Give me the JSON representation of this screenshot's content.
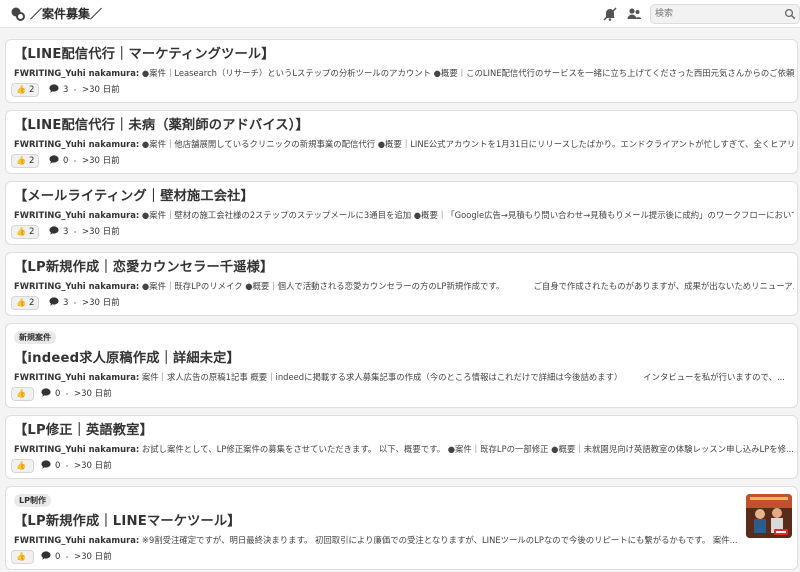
{
  "header": {
    "channel_title": "／案件募集／",
    "search_placeholder": "検索"
  },
  "posts": [
    {
      "tag": "",
      "title": "【LINE配信代行｜マーケティングツール】",
      "author": "FWRITING_Yuhi nakamura:",
      "preview": "●案件｜Leasearch（リサーチ）というLステップの分析ツールのアカウント ●概要｜このLINE配信代行のサービスを一緒に立ち上げてくださった西田元気さんからのご依頼...",
      "reaction_emoji": "👍",
      "reaction_count": "2",
      "replies": "3",
      "time": ">30 日前",
      "has_thumbnail": false
    },
    {
      "tag": "",
      "title": "【LINE配信代行｜未病（薬剤師のアドバイス）】",
      "author": "FWRITING_Yuhi nakamura:",
      "preview": "●案件｜他店舗展開しているクリニックの新規事業の配信代行 ●概要｜LINE公式アカウントを1月31日にリリースしたばかり。エンドクライアントが忙しすぎて、全くヒアリン...",
      "reaction_emoji": "👍",
      "reaction_count": "2",
      "replies": "0",
      "time": ">30 日前",
      "has_thumbnail": false
    },
    {
      "tag": "",
      "title": "【メールライティング｜壁材施工会社】",
      "author": "FWRITING_Yuhi nakamura:",
      "preview": "●案件｜壁材の施工会社様の2ステップのステップメールに3通目を追加 ●概要｜「Google広告→見積もり問い合わせ→見積もりメール提示後に成約」のワークフローにおいて...",
      "reaction_emoji": "👍",
      "reaction_count": "2",
      "replies": "3",
      "time": ">30 日前",
      "has_thumbnail": false
    },
    {
      "tag": "",
      "title": "【LP新規作成｜恋愛カウンセラー千遥様】",
      "author": "FWRITING_Yuhi nakamura:",
      "preview": "●案件｜既存LPのリメイク ●概要｜個人で活動される恋愛カウンセラーの方のLP新規作成です。　　　　ご自身で作成されたものがありますが、成果が出ないためリニューア...",
      "reaction_emoji": "👍",
      "reaction_count": "2",
      "replies": "3",
      "time": ">30 日前",
      "has_thumbnail": false
    },
    {
      "tag": "新規案件",
      "title": "【indeed求人原稿作成｜詳細未定】",
      "author": "FWRITING_Yuhi nakamura:",
      "preview": "案件｜求人広告の原稿1記事 概要｜indeedに掲載する求人募集記事の作成（今のところ情報はこれだけで詳細は今後詰めます）　　　インタビューを私が行いますので、...",
      "reaction_emoji": "👍",
      "reaction_count": "",
      "replies": "0",
      "time": ">30 日前",
      "has_thumbnail": false
    },
    {
      "tag": "",
      "title": "【LP修正｜英語教室】",
      "author": "FWRITING_Yuhi nakamura:",
      "preview": "お試し案件として、LP修正案件の募集をさせていただきます。 以下、概要です。 ●案件｜既存LPの一部修正 ●概要｜未就園児向け英語教室の体験レッスン申し込みLPを修...",
      "reaction_emoji": "👍",
      "reaction_count": "",
      "replies": "0",
      "time": ">30 日前",
      "has_thumbnail": false
    },
    {
      "tag": "LP制作",
      "title": "【LP新規作成｜LINEマーケツール】",
      "author": "FWRITING_Yuhi nakamura:",
      "preview": "※9割受注確定ですが、明日最終決まります。 初回取引により廉価での受注となりますが、LINEツールのLPなので今後のリピートにも繋がるかもです。 案件...",
      "reaction_emoji": "👍",
      "reaction_count": "",
      "replies": "0",
      "time": ">30 日前",
      "has_thumbnail": true
    }
  ]
}
